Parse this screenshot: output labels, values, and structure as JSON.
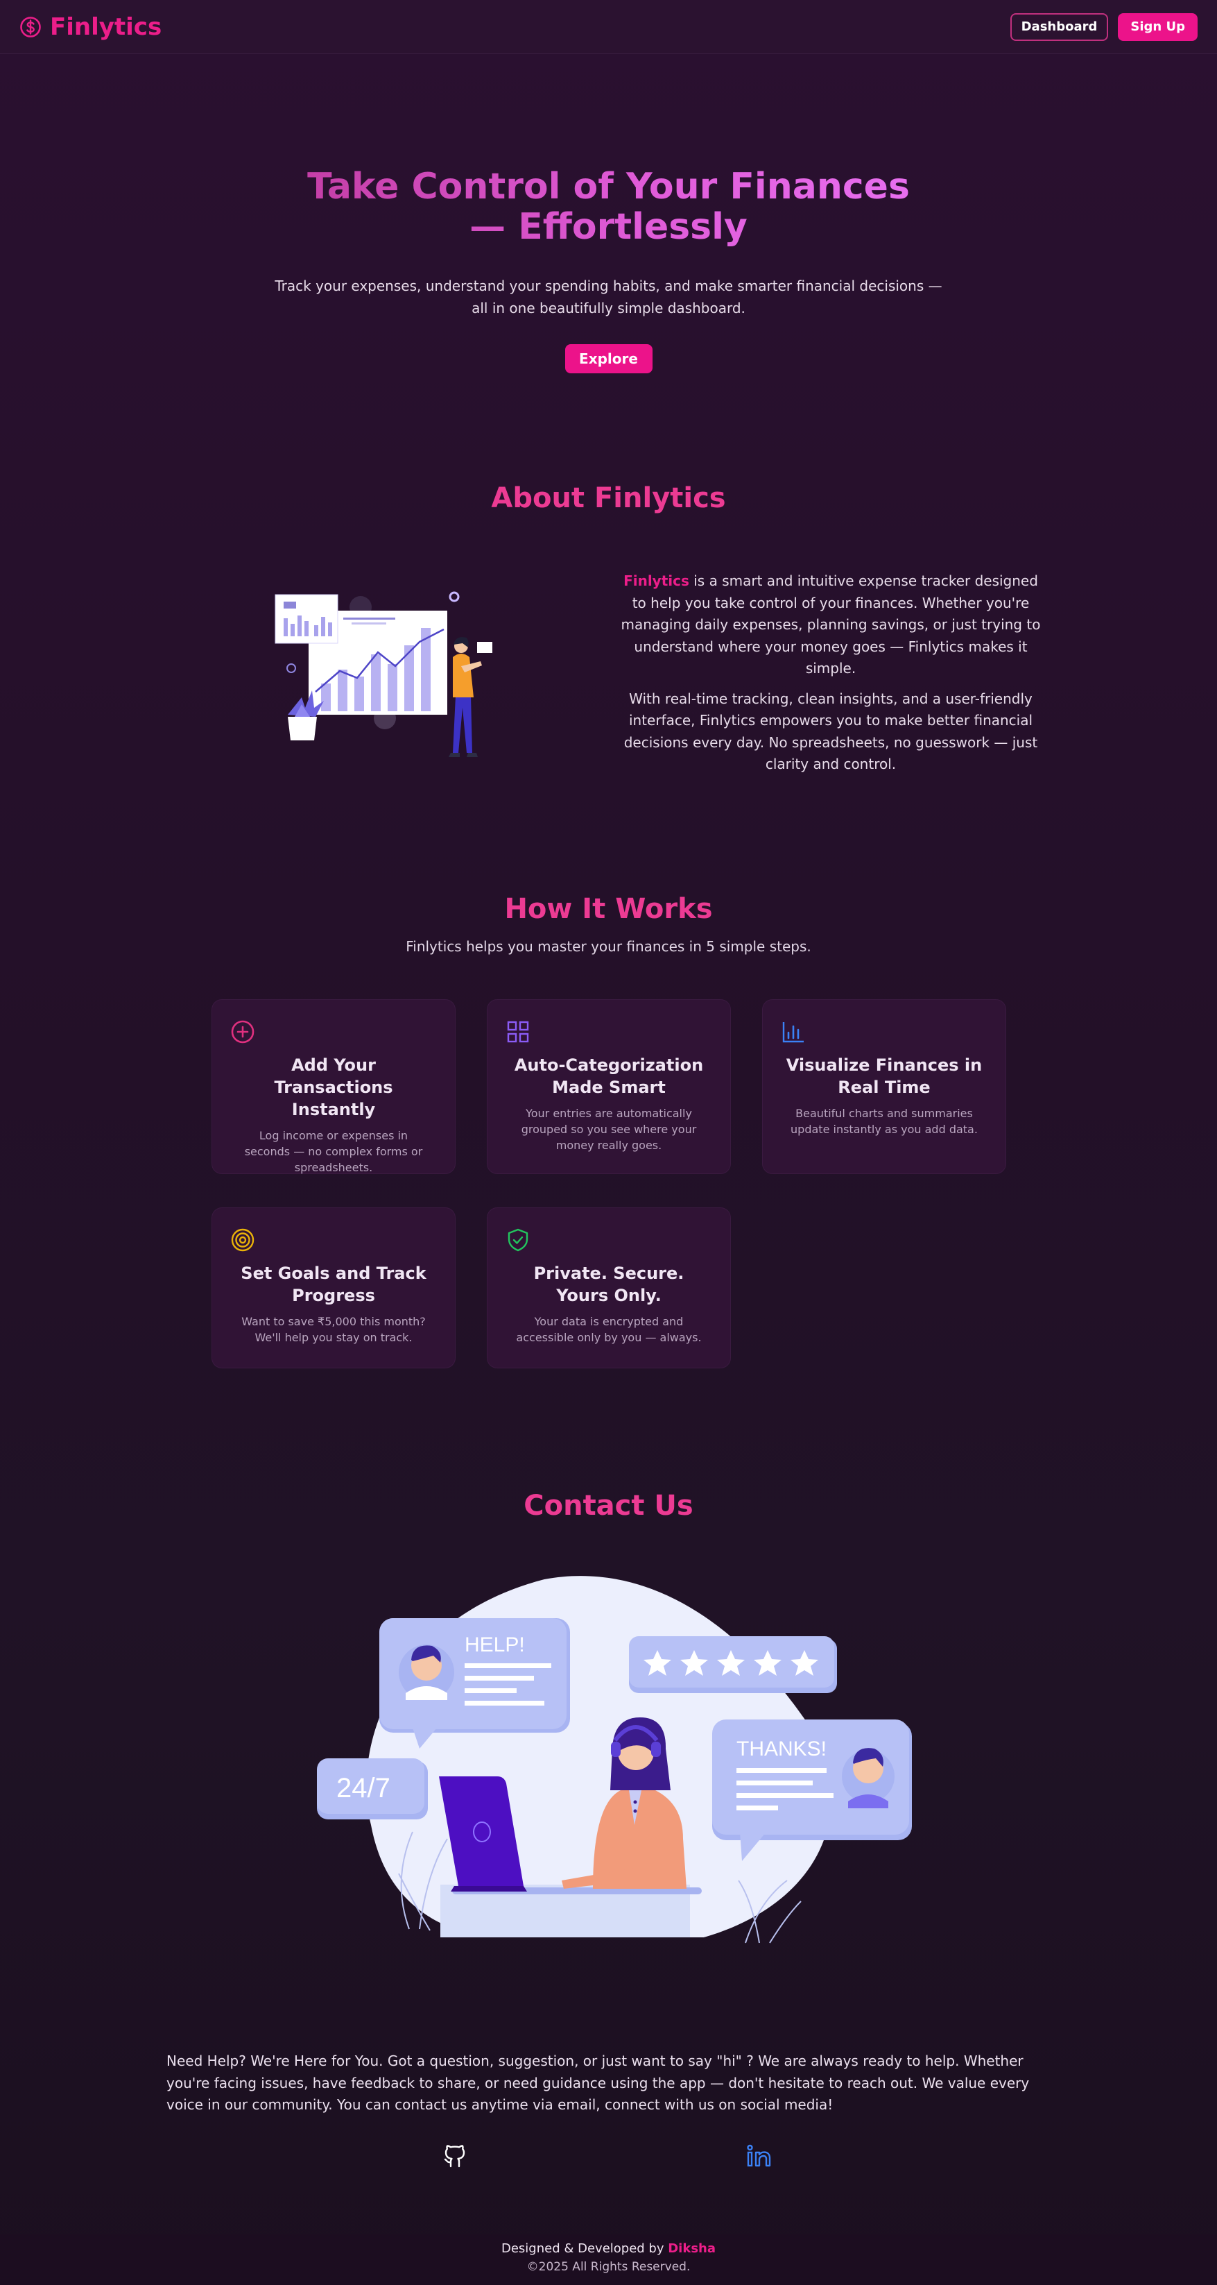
{
  "nav": {
    "brand": "Finlytics",
    "dashboard_label": "Dashboard",
    "signup_label": "Sign Up"
  },
  "hero": {
    "title": "Take Control of Your Finances — Effortlessly",
    "subtitle": "Track your expenses, understand your spending habits, and make smarter financial decisions — all in one beautifully simple dashboard.",
    "cta": "Explore"
  },
  "about": {
    "title": "About Finlytics",
    "brand_inline": "Finlytics",
    "p1_rest": " is a smart and intuitive expense tracker designed to help you take control of your finances. Whether you're managing daily expenses, planning savings, or just trying to understand where your money goes — Finlytics makes it simple.",
    "p2": "With real-time tracking, clean insights, and a user-friendly interface, Finlytics empowers you to make better financial decisions every day. No spreadsheets, no guesswork — just clarity and control."
  },
  "how": {
    "title": "How It Works",
    "subtitle": "Finlytics helps you master your finances in 5 simple steps.",
    "cards": [
      {
        "title": "Add Your Transactions Instantly",
        "desc": "Log income or expenses in seconds — no complex forms or spreadsheets.",
        "icon": "plus-circle-icon",
        "color": "#e0307f"
      },
      {
        "title": "Auto-Categorization Made Smart",
        "desc": "Your entries are automatically grouped so you see where your money really goes.",
        "icon": "grid-icon",
        "color": "#8b5cf6"
      },
      {
        "title": "Visualize Finances in Real Time",
        "desc": "Beautiful charts and summaries update instantly as you add data.",
        "icon": "bar-chart-icon",
        "color": "#3b82f6"
      },
      {
        "title": "Set Goals and Track Progress",
        "desc": "Want to save ₹5,000 this month? We'll help you stay on track.",
        "icon": "target-icon",
        "color": "#eab308"
      },
      {
        "title": "Private. Secure. Yours Only.",
        "desc": "Your data is encrypted and accessible only by you — always.",
        "icon": "shield-check-icon",
        "color": "#22c55e"
      }
    ]
  },
  "contact": {
    "title": "Contact Us",
    "illus_help": "HELP!",
    "illus_247": "24/7",
    "illus_thanks": "THANKS!",
    "text": "Need Help? We're Here for You. Got a question, suggestion, or just want to say \"hi\" ? We are always ready to help. Whether you're facing issues, have feedback to share, or need guidance using the app — don't hesitate to reach out. We value every voice in our community. You can contact us anytime via email, connect with us on social media!",
    "social": [
      "github-icon",
      "linkedin-icon"
    ]
  },
  "footer": {
    "line1_prefix": "Designed & Developed by ",
    "author": "Diksha",
    "copyright": "©2025 All Rights Reserved."
  },
  "colors": {
    "accent": "#ec138a",
    "background": "#241029",
    "card": "#301335"
  }
}
